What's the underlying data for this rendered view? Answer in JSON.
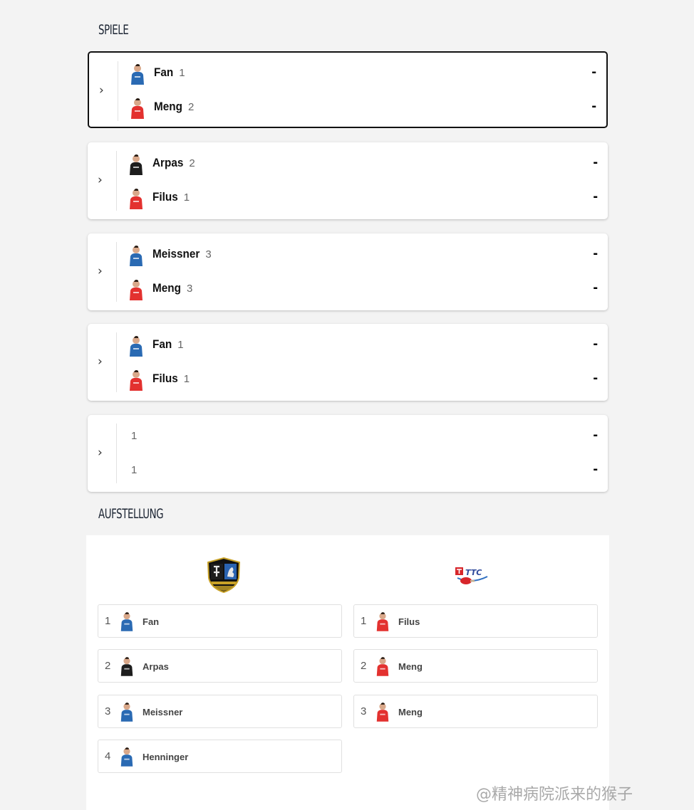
{
  "sections": {
    "spiele": "SPIELE",
    "aufstellung": "AUFSTELLUNG"
  },
  "colors": {
    "home": "#2a6ab3",
    "away": "#e3312f",
    "dark": "#1d1d1d"
  },
  "matches": [
    {
      "home": {
        "name": "Fan",
        "num": "1",
        "kit": "blue"
      },
      "away": {
        "name": "Meng",
        "num": "2",
        "kit": "red"
      },
      "home_score": "-",
      "away_score": "-"
    },
    {
      "home": {
        "name": "Arpas",
        "num": "2",
        "kit": "black"
      },
      "away": {
        "name": "Filus",
        "num": "1",
        "kit": "red"
      },
      "home_score": "-",
      "away_score": "-"
    },
    {
      "home": {
        "name": "Meissner",
        "num": "3",
        "kit": "blue"
      },
      "away": {
        "name": "Meng",
        "num": "3",
        "kit": "red"
      },
      "home_score": "-",
      "away_score": "-"
    },
    {
      "home": {
        "name": "Fan",
        "num": "1",
        "kit": "blue"
      },
      "away": {
        "name": "Filus",
        "num": "1",
        "kit": "red"
      },
      "home_score": "-",
      "away_score": "-"
    },
    {
      "home": {
        "name": "",
        "num": "1",
        "kit": ""
      },
      "away": {
        "name": "",
        "num": "1",
        "kit": ""
      },
      "home_score": "-",
      "away_score": "-"
    }
  ],
  "lineup": {
    "home_logo_icon": "shield-crest-icon",
    "away_logo_icon": "ttc-logo-icon",
    "home": [
      {
        "num": "1",
        "name": "Fan",
        "kit": "blue"
      },
      {
        "num": "2",
        "name": "Arpas",
        "kit": "black"
      },
      {
        "num": "3",
        "name": "Meissner",
        "kit": "blue"
      },
      {
        "num": "4",
        "name": "Henninger",
        "kit": "blue"
      }
    ],
    "away": [
      {
        "num": "1",
        "name": "Filus",
        "kit": "red"
      },
      {
        "num": "2",
        "name": "Meng",
        "kit": "red"
      },
      {
        "num": "3",
        "name": "Meng",
        "kit": "red"
      }
    ]
  },
  "watermark": "@精神病院派来的猴子"
}
